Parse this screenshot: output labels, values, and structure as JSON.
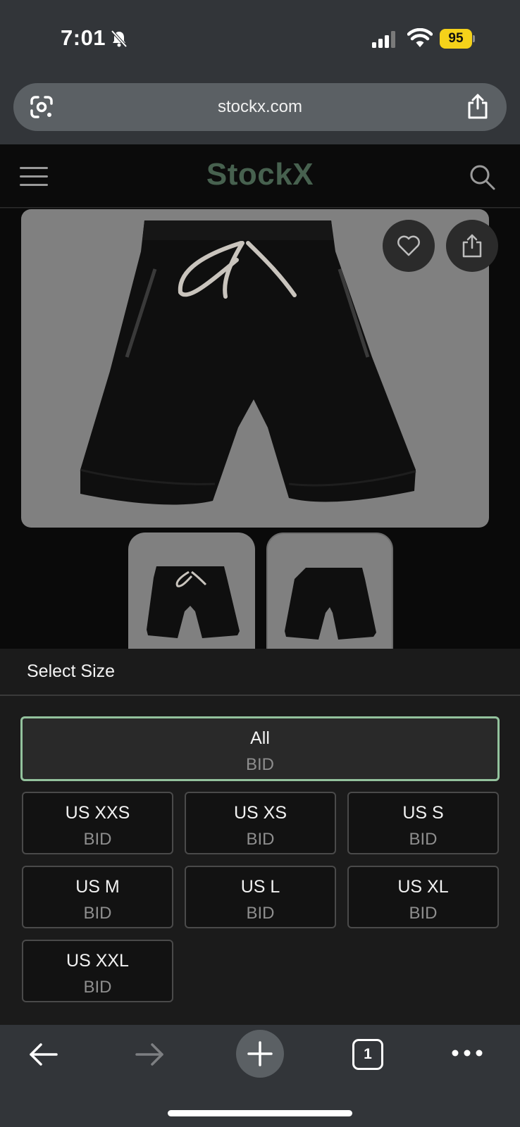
{
  "status_bar": {
    "time": "7:01",
    "battery": "95"
  },
  "browser": {
    "url": "stockx.com",
    "tab_count": "1"
  },
  "site": {
    "logo": "StockX"
  },
  "size_sheet": {
    "title": "Select Size",
    "options": [
      {
        "label": "All",
        "sub": "BID"
      },
      {
        "label": "US XXS",
        "sub": "BID"
      },
      {
        "label": "US XS",
        "sub": "BID"
      },
      {
        "label": "US S",
        "sub": "BID"
      },
      {
        "label": "US M",
        "sub": "BID"
      },
      {
        "label": "US L",
        "sub": "BID"
      },
      {
        "label": "US XL",
        "sub": "BID"
      },
      {
        "label": "US XXL",
        "sub": "BID"
      }
    ],
    "selected": "All"
  },
  "colors": {
    "accent_selected_border": "#93c29d",
    "logo": "#47614f",
    "battery": "#f5d21a"
  }
}
